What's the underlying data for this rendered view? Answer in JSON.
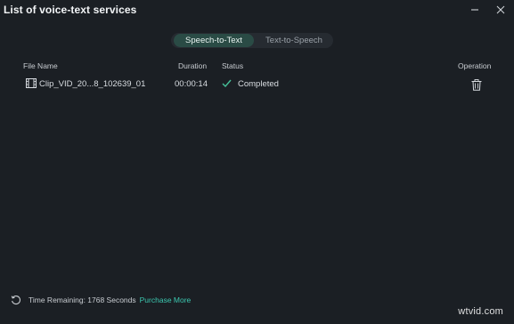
{
  "window": {
    "title": "List of voice-text services"
  },
  "tabs": [
    {
      "label": "Speech-to-Text",
      "active": true
    },
    {
      "label": "Text-to-Speech",
      "active": false
    }
  ],
  "table": {
    "headers": {
      "file_name": "File Name",
      "duration": "Duration",
      "status": "Status",
      "operation": "Operation"
    },
    "rows": [
      {
        "file_name": "Clip_VID_20...8_102639_01",
        "duration": "00:00:14",
        "status": "Completed",
        "file_icon": "film-icon",
        "status_icon": "check-icon",
        "operation_icon": "trash-icon"
      }
    ]
  },
  "footer": {
    "time_remaining": "Time Remaining: 1768 Seconds",
    "purchase_label": "Purchase More"
  },
  "watermark": "wtvid.com",
  "colors": {
    "background": "#1b1f24",
    "accent": "#3cc8b0",
    "active_tab": "#2a4b45",
    "check": "#46c29a"
  }
}
